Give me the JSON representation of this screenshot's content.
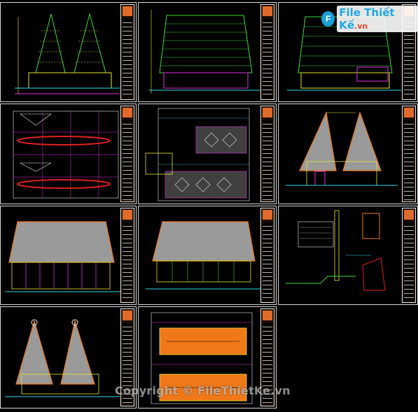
{
  "brand": {
    "name": "File Thiết Kế",
    "tld": ".vn",
    "mark": "F"
  },
  "watermark": {
    "text": "Copyright © FileThietKe.vn"
  },
  "sheets": [
    {
      "id": "elevation-twin-peak-1",
      "view": "front elevation, twin-peak roof"
    },
    {
      "id": "elevation-broad-roof-1",
      "view": "side elevation, broad thatched roof"
    },
    {
      "id": "elevation-broad-roof-2",
      "view": "side elevation, broad roof with panel"
    },
    {
      "id": "floor-plan-red-beams",
      "view": "floor plan"
    },
    {
      "id": "floor-plan-diamond-grid",
      "view": "site plan"
    },
    {
      "id": "section-twin-peak",
      "view": "section, twin-peak roof"
    },
    {
      "id": "elevation-grey-roof-1",
      "view": "elevation, grey roof"
    },
    {
      "id": "elevation-grey-roof-2",
      "view": "elevation, grey roof"
    },
    {
      "id": "detail-drawings",
      "view": "construction details"
    },
    {
      "id": "section-twin-peak-2",
      "view": "section, twin-peak roof"
    },
    {
      "id": "roof-plan-orange",
      "view": "roof plan"
    }
  ],
  "colors": {
    "background": "#000000",
    "line_yellow": "#e8e830",
    "line_green": "#3ddc3d",
    "line_cyan": "#30d8e8",
    "line_magenta": "#e030e0",
    "line_red": "#e02020",
    "roof_grey": "#9a9a9a",
    "roof_orange": "#f07818",
    "titleblock_orange": "#e06a2a"
  }
}
